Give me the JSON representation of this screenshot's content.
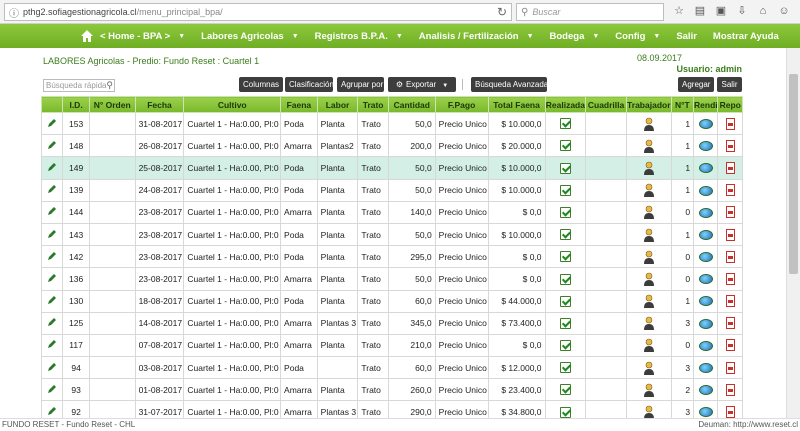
{
  "browser": {
    "url_host": "pthg2.sofiagestionagricola.cl",
    "url_path": "/menu_principal_bpa/",
    "search_placeholder": "Buscar"
  },
  "nav": {
    "items": [
      {
        "label": "< Home - BPA >",
        "has_menu": true
      },
      {
        "label": "Labores Agricolas",
        "has_menu": true
      },
      {
        "label": "Registros B.P.A.",
        "has_menu": true
      },
      {
        "label": "Analisis / Fertilización",
        "has_menu": true
      },
      {
        "label": "Bodega",
        "has_menu": true
      },
      {
        "label": "Config",
        "has_menu": true
      },
      {
        "label": "Salir",
        "has_menu": false
      },
      {
        "label": "Mostrar Ayuda",
        "has_menu": false
      }
    ]
  },
  "header": {
    "title": "LABORES Agricolas - Predio: Fundo Reset : Cuartel 1",
    "date": "08.09.2017",
    "user": "Usuario: admin",
    "quick_search_placeholder": "Búsqueda rápida"
  },
  "toolbar": {
    "columnas": "Columnas",
    "clasificacion": "Clasificación",
    "agrupar": "Agrupar por",
    "exportar": "Exportar",
    "busqueda_avanzada": "Búsqueda Avanzada",
    "agregar": "Agregar",
    "salir": "Salir"
  },
  "table": {
    "columns": [
      "",
      "I.D.",
      "N° Orden",
      "Fecha",
      "Cultivo",
      "Faena",
      "Labor",
      "Trato",
      "Cantidad",
      "F.Pago",
      "Total Faena",
      "Realizada",
      "Cuadrilla",
      "Trabajador",
      "N°T",
      "Rendi",
      "Repo"
    ],
    "rows": [
      {
        "id": "153",
        "orden": "",
        "fecha": "31-08-2017",
        "cultivo": "Cuartel 1 - Ha:0.00, Pl:0",
        "faena": "Poda",
        "labor": "Planta",
        "trato": "Trato",
        "cantidad": "50,0",
        "fpago": "Precio Unico",
        "total": "$ 10.000,0",
        "nt": "1",
        "highlight": false
      },
      {
        "id": "148",
        "orden": "",
        "fecha": "26-08-2017",
        "cultivo": "Cuartel 1 - Ha:0.00, Pl:0",
        "faena": "Amarra",
        "labor": "Plantas2",
        "trato": "Trato",
        "cantidad": "200,0",
        "fpago": "Precio Unico",
        "total": "$ 20.000,0",
        "nt": "1",
        "highlight": false
      },
      {
        "id": "149",
        "orden": "",
        "fecha": "25-08-2017",
        "cultivo": "Cuartel 1 - Ha:0.00, Pl:0",
        "faena": "Poda",
        "labor": "Planta",
        "trato": "Trato",
        "cantidad": "50,0",
        "fpago": "Precio Unico",
        "total": "$ 10.000,0",
        "nt": "1",
        "highlight": true
      },
      {
        "id": "139",
        "orden": "",
        "fecha": "24-08-2017",
        "cultivo": "Cuartel 1 - Ha:0.00, Pl:0",
        "faena": "Poda",
        "labor": "Planta",
        "trato": "Trato",
        "cantidad": "50,0",
        "fpago": "Precio Unico",
        "total": "$ 10.000,0",
        "nt": "1",
        "highlight": false
      },
      {
        "id": "144",
        "orden": "",
        "fecha": "23-08-2017",
        "cultivo": "Cuartel 1 - Ha:0.00, Pl:0",
        "faena": "Amarra",
        "labor": "Planta",
        "trato": "Trato",
        "cantidad": "140,0",
        "fpago": "Precio Unico",
        "total": "$ 0,0",
        "nt": "0",
        "highlight": false
      },
      {
        "id": "143",
        "orden": "",
        "fecha": "23-08-2017",
        "cultivo": "Cuartel 1 - Ha:0.00, Pl:0",
        "faena": "Poda",
        "labor": "Planta",
        "trato": "Trato",
        "cantidad": "50,0",
        "fpago": "Precio Unico",
        "total": "$ 10.000,0",
        "nt": "1",
        "highlight": false
      },
      {
        "id": "142",
        "orden": "",
        "fecha": "23-08-2017",
        "cultivo": "Cuartel 1 - Ha:0.00, Pl:0",
        "faena": "Poda",
        "labor": "Planta",
        "trato": "Trato",
        "cantidad": "295,0",
        "fpago": "Precio Unico",
        "total": "$ 0,0",
        "nt": "0",
        "highlight": false
      },
      {
        "id": "136",
        "orden": "",
        "fecha": "23-08-2017",
        "cultivo": "Cuartel 1 - Ha:0.00, Pl:0",
        "faena": "Amarra",
        "labor": "Planta",
        "trato": "Trato",
        "cantidad": "50,0",
        "fpago": "Precio Unico",
        "total": "$ 0,0",
        "nt": "0",
        "highlight": false
      },
      {
        "id": "130",
        "orden": "",
        "fecha": "18-08-2017",
        "cultivo": "Cuartel 1 - Ha:0.00, Pl:0",
        "faena": "Poda",
        "labor": "Planta",
        "trato": "Trato",
        "cantidad": "60,0",
        "fpago": "Precio Unico",
        "total": "$ 44.000,0",
        "nt": "1",
        "highlight": false
      },
      {
        "id": "125",
        "orden": "",
        "fecha": "14-08-2017",
        "cultivo": "Cuartel 1 - Ha:0.00, Pl:0",
        "faena": "Amarra",
        "labor": "Plantas 3",
        "trato": "Trato",
        "cantidad": "345,0",
        "fpago": "Precio Unico",
        "total": "$ 73.400,0",
        "nt": "3",
        "highlight": false
      },
      {
        "id": "117",
        "orden": "",
        "fecha": "07-08-2017",
        "cultivo": "Cuartel 1 - Ha:0.00, Pl:0",
        "faena": "Amarra",
        "labor": "Planta",
        "trato": "Trato",
        "cantidad": "210,0",
        "fpago": "Precio Unico",
        "total": "$ 0,0",
        "nt": "0",
        "highlight": false
      },
      {
        "id": "94",
        "orden": "",
        "fecha": "03-08-2017",
        "cultivo": "Cuartel 1 - Ha:0.00, Pl:0",
        "faena": "Poda",
        "labor": "",
        "trato": "Trato",
        "cantidad": "60,0",
        "fpago": "Precio Unico",
        "total": "$ 12.000,0",
        "nt": "3",
        "highlight": false
      },
      {
        "id": "93",
        "orden": "",
        "fecha": "01-08-2017",
        "cultivo": "Cuartel 1 - Ha:0.00, Pl:0",
        "faena": "Amarra",
        "labor": "Planta",
        "trato": "Trato",
        "cantidad": "260,0",
        "fpago": "Precio Unico",
        "total": "$ 23.400,0",
        "nt": "2",
        "highlight": false
      },
      {
        "id": "92",
        "orden": "",
        "fecha": "31-07-2017",
        "cultivo": "Cuartel 1 - Ha:0.00, Pl:0",
        "faena": "Amarra",
        "labor": "Plantas 3",
        "trato": "Trato",
        "cantidad": "290,0",
        "fpago": "Precio Unico",
        "total": "$ 34.800,0",
        "nt": "3",
        "highlight": false
      }
    ]
  },
  "status": {
    "left": "FUNDO RESET - Fundo Reset - CHL",
    "right": "Deuman: http://www.reset.cl"
  },
  "colors": {
    "accent_green": "#79b82c",
    "row_highlight": "#d4efe6",
    "title_green": "#3a7d1c"
  }
}
